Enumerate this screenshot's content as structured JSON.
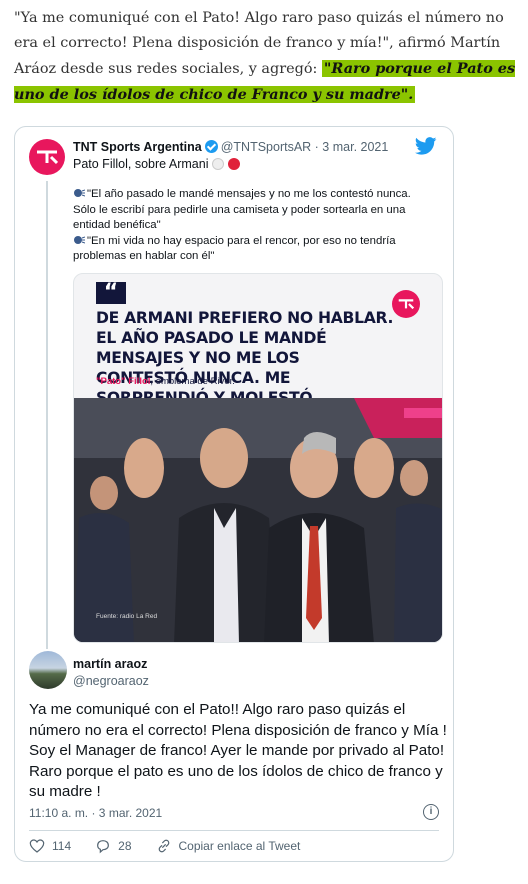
{
  "article": {
    "paragraph_plain": "\"Ya me comuniqué con el Pato! Algo raro paso quizás el número no era el correcto! Plena disposición de franco y mía!\", afirmó Martín Aráoz desde sus redes sociales, y agregó: ",
    "paragraph_highlight": "\"Raro porque el Pato es uno de los ídolos de chico de Franco y su madre\"."
  },
  "tweet": {
    "quoted": {
      "author_name": "TNT Sports Argentina",
      "handle_date": "@TNTSportsAR · 3 mar. 2021",
      "subtitle": "Pato Fillol, sobre Armani",
      "quote_1": "\"El año pasado le mandé mensajes y no me los contestó nunca. Sólo le escribí para pedirle una camiseta y poder sortearla en una entidad benéfica\"",
      "quote_2": "\"En mi vida no hay espacio para el rencor, por eso no tendría problemas en hablar con él\"",
      "media": {
        "quote_glyph": "“",
        "headline": "DE ARMANI PREFIERO NO HABLAR. EL AÑO PASADO LE MANDÉ MENSAJES Y NO ME LOS CONTESTÓ NUNCA. ME SORPRENDIÓ Y MOLESTÓ",
        "caption_name": "\"Pato\" Fillol",
        "caption_rest": ", emblema de River.",
        "source": "Fuente: radio La Red"
      }
    },
    "reply": {
      "author_name": "martín araoz",
      "handle": "@negroaraoz",
      "text": "Ya me comuniqué con el Pato!! Algo raro paso quizás el número no era el correcto! Plena disposición de franco y Mía ! Soy el Manager de franco! Ayer le mande por privado al Pato! Raro porque el pato es uno de los ídolos de chico de franco y su madre !",
      "timestamp": "11:10 a. m. · 3 mar. 2021",
      "likes": "114",
      "replies": "28",
      "copy_link_label": "Copiar enlace al Tweet"
    }
  },
  "icons": {
    "verified": "verified-badge-icon",
    "bird": "twitter-bird-icon",
    "speaker": "speaking-head-icon",
    "info": "info-icon",
    "heart": "heart-icon",
    "reply": "reply-bubble-icon",
    "link": "link-icon"
  },
  "colors": {
    "highlight": "#8bc400",
    "tnt_pink": "#e8175d",
    "twitter_blue": "#1d9bf0",
    "headline_navy": "#12163a",
    "muted": "#536471"
  }
}
